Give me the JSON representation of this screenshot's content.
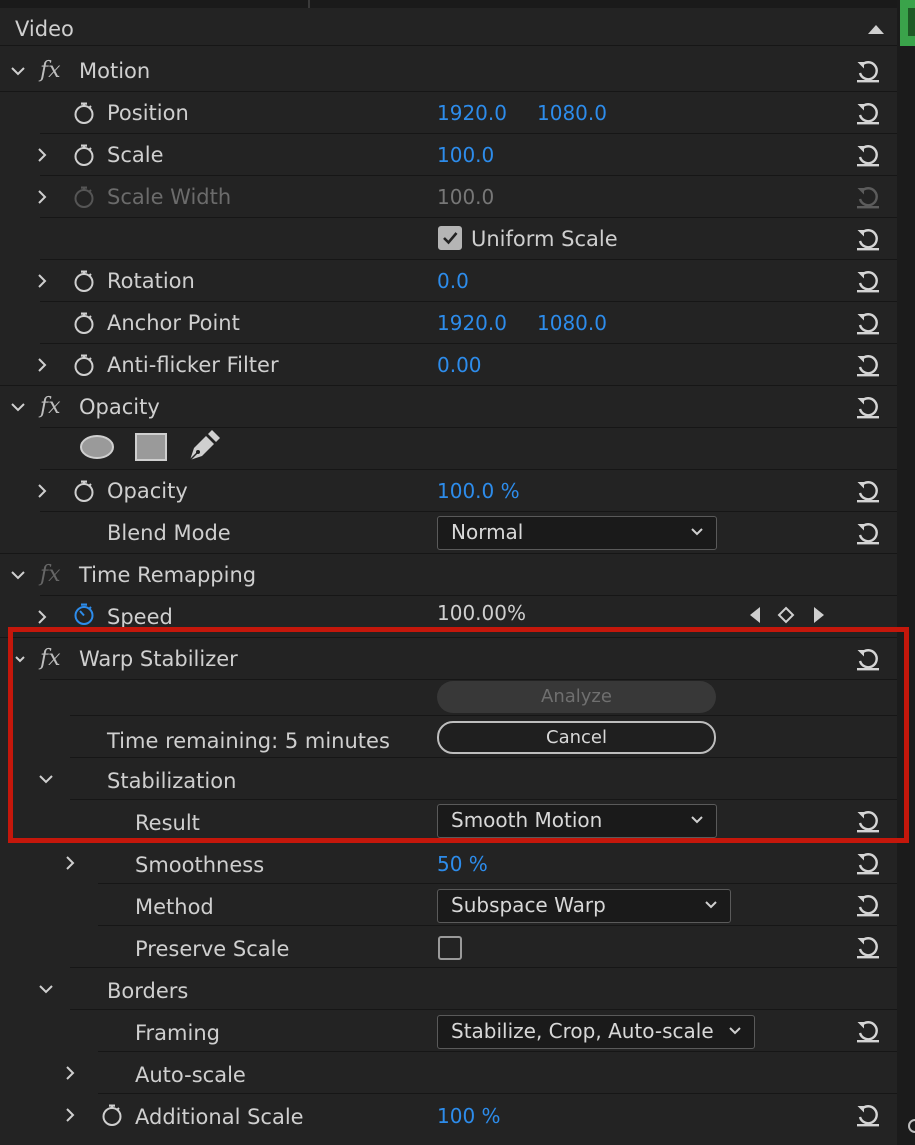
{
  "header": {
    "title": "Video"
  },
  "motion": {
    "title": "Motion",
    "fx": "fx",
    "position": {
      "label": "Position",
      "x": "1920.0",
      "y": "1080.0"
    },
    "scale": {
      "label": "Scale",
      "value": "100.0"
    },
    "scale_width": {
      "label": "Scale Width",
      "value": "100.0"
    },
    "uniform_scale": {
      "label": "Uniform Scale",
      "checked": true
    },
    "rotation": {
      "label": "Rotation",
      "value": "0.0"
    },
    "anchor_point": {
      "label": "Anchor Point",
      "x": "1920.0",
      "y": "1080.0"
    },
    "anti_flicker": {
      "label": "Anti-flicker Filter",
      "value": "0.00"
    }
  },
  "opacity": {
    "title": "Opacity",
    "fx": "fx",
    "opacity": {
      "label": "Opacity",
      "value": "100.0 %"
    },
    "blend_mode": {
      "label": "Blend Mode",
      "value": "Normal"
    }
  },
  "time_remapping": {
    "title": "Time Remapping",
    "fx": "fx",
    "speed": {
      "label": "Speed",
      "value": "100.00%"
    }
  },
  "warp": {
    "title": "Warp Stabilizer",
    "fx": "fx",
    "analyze_label": "Analyze",
    "time_remaining": "Time remaining: 5 minutes",
    "cancel_label": "Cancel",
    "stabilization": {
      "label": "Stabilization",
      "result": {
        "label": "Result",
        "value": "Smooth Motion"
      },
      "smoothness": {
        "label": "Smoothness",
        "value": "50 %"
      },
      "method": {
        "label": "Method",
        "value": "Subspace Warp"
      },
      "preserve_scale": {
        "label": "Preserve Scale",
        "checked": false
      }
    },
    "borders": {
      "label": "Borders",
      "framing": {
        "label": "Framing",
        "value": "Stabilize, Crop, Auto-scale"
      },
      "auto_scale": {
        "label": "Auto-scale"
      },
      "additional_scale": {
        "label": "Additional Scale",
        "value": "100 %"
      }
    }
  },
  "colors": {
    "accent": "#2d8ceb",
    "highlight": "#c4170b",
    "panel": "#232323"
  }
}
